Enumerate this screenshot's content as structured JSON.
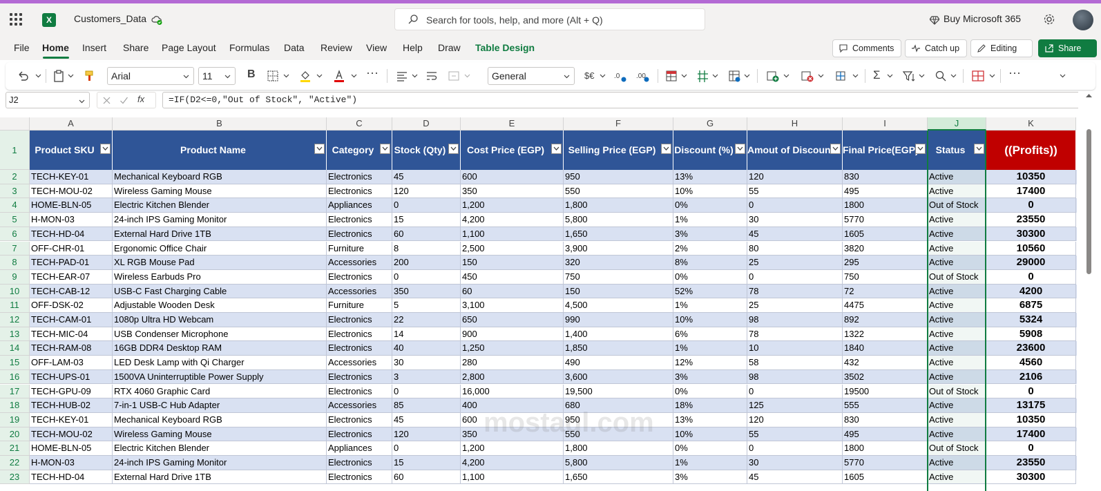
{
  "app": {
    "document_name": "Customers_Data",
    "search_placeholder": "Search for tools, help, and more (Alt + Q)",
    "buy_label": "Buy Microsoft 365"
  },
  "menu": {
    "tabs": [
      "File",
      "Home",
      "Insert",
      "Share",
      "Page Layout",
      "Formulas",
      "Data",
      "Review",
      "View",
      "Help",
      "Draw",
      "Table Design"
    ],
    "active_tab": "Home",
    "comments_label": "Comments",
    "catchup_label": "Catch up",
    "editing_label": "Editing",
    "share_label": "Share"
  },
  "ribbon": {
    "font_name": "Arial",
    "font_size": "11",
    "number_format": "General",
    "currency_symbol": "$€"
  },
  "formula_bar": {
    "name_box": "J2",
    "formula": "=IF(D2<=0,\"Out of Stock\", \"Active\")"
  },
  "sheet": {
    "column_letters": [
      "A",
      "B",
      "C",
      "D",
      "E",
      "F",
      "G",
      "H",
      "I",
      "J",
      "K"
    ],
    "selected_column": "J",
    "headers": [
      "Product SKU",
      "Product Name",
      "Category",
      "Stock (Qty)",
      "Cost Price (EGP)",
      "Selling Price (EGP)",
      "Discount (%)",
      "Amout of Discount",
      "Final Price(EGP)",
      "Status",
      "((Profits))"
    ],
    "rows": [
      [
        "2",
        "TECH-KEY-01",
        "Mechanical Keyboard RGB",
        "Electronics",
        "45",
        "600",
        "950",
        "13%",
        "120",
        "830",
        "Active",
        "10350"
      ],
      [
        "3",
        "TECH-MOU-02",
        "Wireless Gaming Mouse",
        "Electronics",
        "120",
        "350",
        "550",
        "10%",
        "55",
        "495",
        "Active",
        "17400"
      ],
      [
        "4",
        "HOME-BLN-05",
        "Electric Kitchen Blender",
        "Appliances",
        "0",
        "1,200",
        "1,800",
        "0%",
        "0",
        "1800",
        "Out of Stock",
        "0"
      ],
      [
        "5",
        "H-MON-03",
        "24-inch IPS Gaming Monitor",
        "Electronics",
        "15",
        "4,200",
        "5,800",
        "1%",
        "30",
        "5770",
        "Active",
        "23550"
      ],
      [
        "6",
        "TECH-HD-04",
        "External Hard Drive 1TB",
        "Electronics",
        "60",
        "1,100",
        "1,650",
        "3%",
        "45",
        "1605",
        "Active",
        "30300"
      ],
      [
        "7",
        "OFF-CHR-01",
        "Ergonomic Office Chair",
        "Furniture",
        "8",
        "2,500",
        "3,900",
        "2%",
        "80",
        "3820",
        "Active",
        "10560"
      ],
      [
        "8",
        "TECH-PAD-01",
        "XL RGB Mouse Pad",
        "Accessories",
        "200",
        "150",
        "320",
        "8%",
        "25",
        "295",
        "Active",
        "29000"
      ],
      [
        "9",
        "TECH-EAR-07",
        "Wireless Earbuds Pro",
        "Electronics",
        "0",
        "450",
        "750",
        "0%",
        "0",
        "750",
        "Out of Stock",
        "0"
      ],
      [
        "10",
        "TECH-CAB-12",
        "USB-C Fast Charging Cable",
        "Accessories",
        "350",
        "60",
        "150",
        "52%",
        "78",
        "72",
        "Active",
        "4200"
      ],
      [
        "11",
        "OFF-DSK-02",
        "Adjustable Wooden Desk",
        "Furniture",
        "5",
        "3,100",
        "4,500",
        "1%",
        "25",
        "4475",
        "Active",
        "6875"
      ],
      [
        "12",
        "TECH-CAM-01",
        "1080p Ultra HD Webcam",
        "Electronics",
        "22",
        "650",
        "990",
        "10%",
        "98",
        "892",
        "Active",
        "5324"
      ],
      [
        "13",
        "TECH-MIC-04",
        "USB Condenser Microphone",
        "Electronics",
        "14",
        "900",
        "1,400",
        "6%",
        "78",
        "1322",
        "Active",
        "5908"
      ],
      [
        "14",
        "TECH-RAM-08",
        "16GB DDR4 Desktop RAM",
        "Electronics",
        "40",
        "1,250",
        "1,850",
        "1%",
        "10",
        "1840",
        "Active",
        "23600"
      ],
      [
        "15",
        "OFF-LAM-03",
        "LED Desk Lamp with Qi Charger",
        "Accessories",
        "30",
        "280",
        "490",
        "12%",
        "58",
        "432",
        "Active",
        "4560"
      ],
      [
        "16",
        "TECH-UPS-01",
        "1500VA Uninterruptible Power Supply",
        "Electronics",
        "3",
        "2,800",
        "3,600",
        "3%",
        "98",
        "3502",
        "Active",
        "2106"
      ],
      [
        "17",
        "TECH-GPU-09",
        "RTX 4060 Graphic Card",
        "Electronics",
        "0",
        "16,000",
        "19,500",
        "0%",
        "0",
        "19500",
        "Out of Stock",
        "0"
      ],
      [
        "18",
        "TECH-HUB-02",
        "7-in-1 USB-C Hub Adapter",
        "Accessories",
        "85",
        "400",
        "680",
        "18%",
        "125",
        "555",
        "Active",
        "13175"
      ],
      [
        "19",
        "TECH-KEY-01",
        "Mechanical Keyboard RGB",
        "Electronics",
        "45",
        "600",
        "950",
        "13%",
        "120",
        "830",
        "Active",
        "10350"
      ],
      [
        "20",
        "TECH-MOU-02",
        "Wireless Gaming Mouse",
        "Electronics",
        "120",
        "350",
        "550",
        "10%",
        "55",
        "495",
        "Active",
        "17400"
      ],
      [
        "21",
        "HOME-BLN-05",
        "Electric Kitchen Blender",
        "Appliances",
        "0",
        "1,200",
        "1,800",
        "0%",
        "0",
        "1800",
        "Out of Stock",
        "0"
      ],
      [
        "22",
        "H-MON-03",
        "24-inch IPS Gaming Monitor",
        "Electronics",
        "15",
        "4,200",
        "5,800",
        "1%",
        "30",
        "5770",
        "Active",
        "23550"
      ],
      [
        "23",
        "TECH-HD-04",
        "External Hard Drive 1TB",
        "Electronics",
        "60",
        "1,100",
        "1,650",
        "3%",
        "45",
        "1605",
        "Active",
        "30300"
      ]
    ]
  },
  "watermark": "mostaql.com",
  "colors": {
    "excel_green": "#107c41",
    "header_blue": "#2f5597",
    "profit_red": "#c00000",
    "band_blue": "#d9e1f2"
  }
}
